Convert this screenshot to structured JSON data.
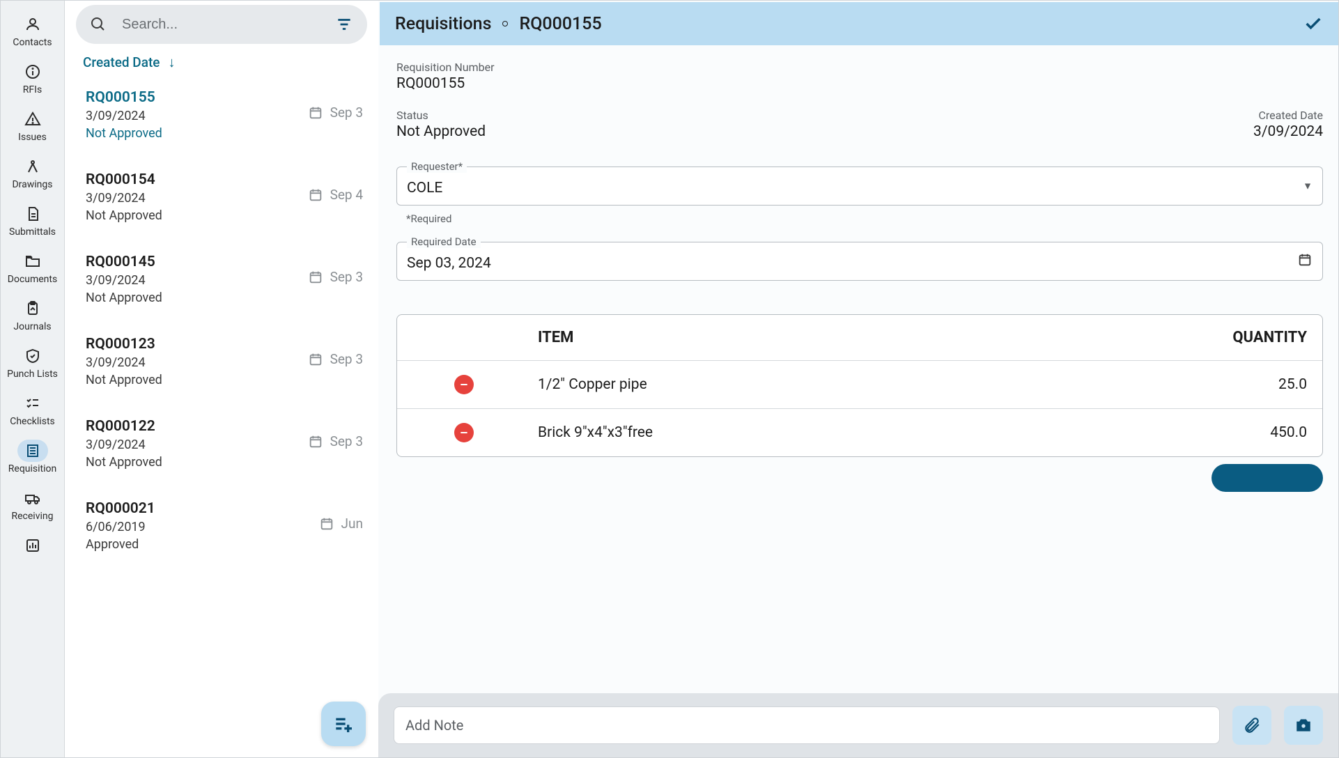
{
  "sidebar": {
    "items": [
      {
        "label": "Contacts"
      },
      {
        "label": "RFIs"
      },
      {
        "label": "Issues"
      },
      {
        "label": "Drawings"
      },
      {
        "label": "Submittals"
      },
      {
        "label": "Documents"
      },
      {
        "label": "Journals"
      },
      {
        "label": "Punch Lists"
      },
      {
        "label": "Checklists"
      },
      {
        "label": "Requisition"
      },
      {
        "label": "Receiving"
      }
    ]
  },
  "search": {
    "placeholder": "Search..."
  },
  "sort": {
    "label": "Created Date"
  },
  "list": [
    {
      "id": "RQ000155",
      "date": "3/09/2024",
      "status": "Not Approved",
      "badge": "Sep 3",
      "selected": true
    },
    {
      "id": "RQ000154",
      "date": "3/09/2024",
      "status": "Not Approved",
      "badge": "Sep 4",
      "selected": false
    },
    {
      "id": "RQ000145",
      "date": "3/09/2024",
      "status": "Not Approved",
      "badge": "Sep 3",
      "selected": false
    },
    {
      "id": "RQ000123",
      "date": "3/09/2024",
      "status": "Not Approved",
      "badge": "Sep 3",
      "selected": false
    },
    {
      "id": "RQ000122",
      "date": "3/09/2024",
      "status": "Not Approved",
      "badge": "Sep 3",
      "selected": false
    },
    {
      "id": "RQ000021",
      "date": "6/06/2019",
      "status": "Approved",
      "badge": "Jun",
      "selected": false
    }
  ],
  "detail": {
    "breadcrumb_root": "Requisitions",
    "breadcrumb_id": "RQ000155",
    "labels": {
      "req_number": "Requisition Number",
      "status": "Status",
      "created_date": "Created Date",
      "requester": "Requester*",
      "required_hint": "*Required",
      "required_date": "Required Date",
      "item_header": "ITEM",
      "qty_header": "QUANTITY",
      "add_note": "Add Note"
    },
    "req_number": "RQ000155",
    "status": "Not Approved",
    "created_date": "3/09/2024",
    "requester": "COLE",
    "required_date": "Sep 03, 2024",
    "items": [
      {
        "name": "1/2\" Copper pipe",
        "qty": "25.0"
      },
      {
        "name": "Brick 9\"x4\"x3\"free",
        "qty": "450.0"
      }
    ]
  }
}
